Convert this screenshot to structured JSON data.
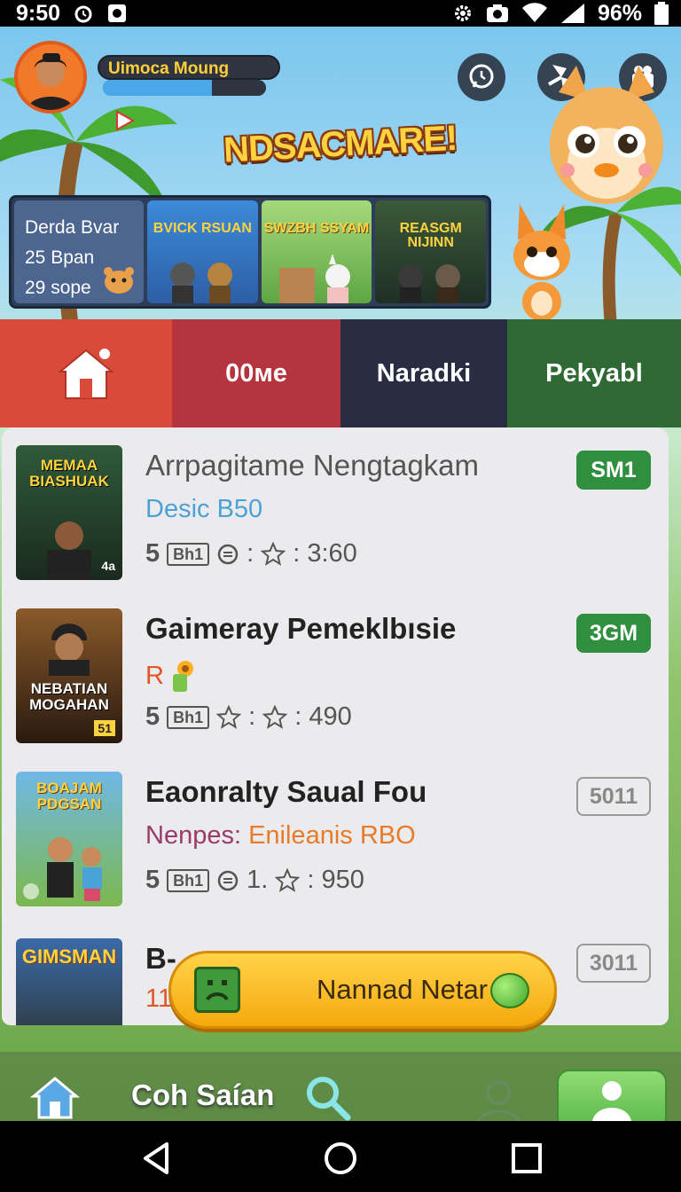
{
  "status_bar": {
    "time": "9:50",
    "battery": "96%"
  },
  "header": {
    "username": "Uimoca Moung",
    "xp_progress": 0.67,
    "title": "NDSACMARE!"
  },
  "featured": {
    "info_lines": [
      "Derda Bvar",
      "25 Bpan",
      "29 sope"
    ],
    "thumbs": [
      {
        "label": "BVICK RSUAN",
        "tag": ""
      },
      {
        "label": "SWZBH SSYAM",
        "tag": ""
      },
      {
        "label": "REASGM NIJINN",
        "tag": ""
      }
    ]
  },
  "tabs": [
    "00ме",
    "Naradki",
    "Pekyabl"
  ],
  "list": [
    {
      "thumb_text": "MEMAA BIASHUAK",
      "thumb_corner": "4a",
      "title": "Arrpagitame Nengtagkam",
      "subtitle": "Desic B50",
      "meta_count": "5",
      "meta_tag": "Bh1",
      "meta_sep": ":",
      "meta_rating": "3:60",
      "badge": "SM1"
    },
    {
      "thumb_text": "NEBATIAN MOGAHAN",
      "thumb_corner": "51",
      "title": "Gaimeray Pemeklbısie",
      "subtitle": "R",
      "meta_count": "5",
      "meta_tag": "Bh1",
      "meta_sep": ":",
      "meta_rating": "490",
      "badge": "3GM"
    },
    {
      "thumb_text": "BOAJAM PDGSAN",
      "thumb_corner": "",
      "title": "Eaonralty Saual Fou",
      "subtitle_a": "Nenpes:",
      "subtitle_b": "Enileanis RBO",
      "meta_count": "5",
      "meta_tag": "Bh1",
      "meta_sep": "1.",
      "meta_rating": "950",
      "badge": "5011"
    },
    {
      "thumb_text": "GIMSMAN",
      "thumb_corner": "",
      "title": "B-",
      "subtitle": "117",
      "badge": "3011"
    }
  ],
  "cta": {
    "label": "Nannad Netar"
  },
  "bottom_bar": {
    "label": "Coh Saían"
  },
  "icons": [
    "home-icon",
    "search-icon",
    "profile-icon",
    "chat-icon",
    "shop-icon",
    "friends-icon",
    "back-icon",
    "home-circle-icon",
    "recents-icon"
  ],
  "colors": {
    "tab_home": "#d94a3a",
    "tab_1": "#b5343d",
    "tab_2": "#2a2c44",
    "tab_3": "#2f6a34",
    "badge_green": "#2f8f3e",
    "accent_yellow": "#ffd23f"
  }
}
